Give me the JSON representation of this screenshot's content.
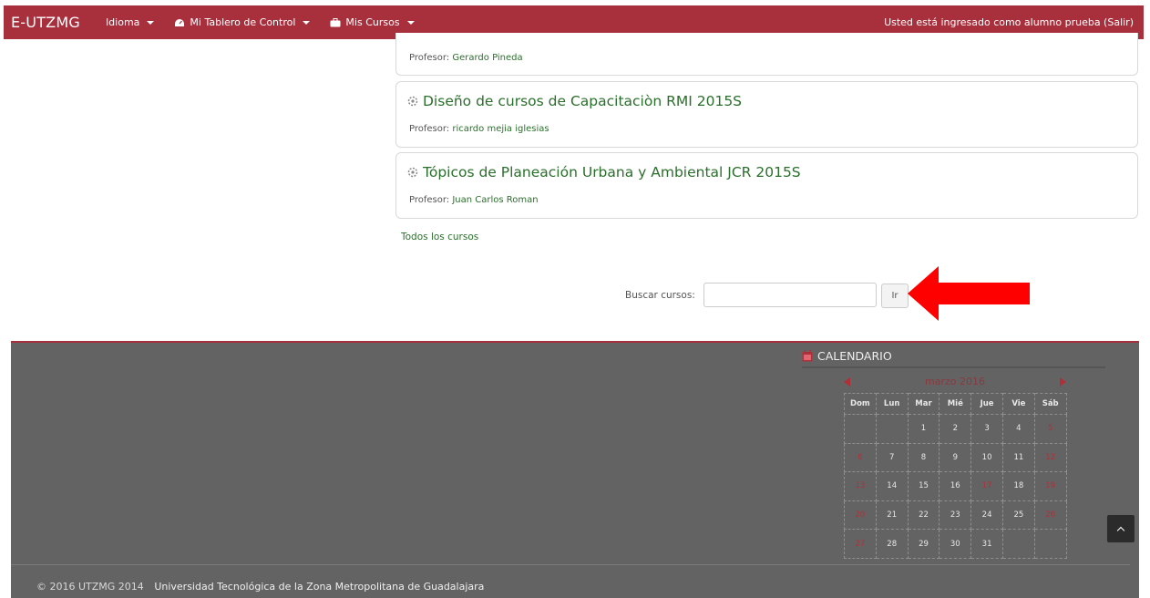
{
  "navbar": {
    "brand": "E-UTZMG",
    "language": "Idioma",
    "dashboard": "Mi Tablero de Control",
    "my_courses": "Mis Cursos",
    "login_info": "Usted está ingresado como alumno prueba (Salir)"
  },
  "courses": [
    {
      "teacher_label": "Profesor:",
      "teacher": "Gerardo Pineda"
    },
    {
      "title": "Diseño de cursos de Capacitaciòn RMI 2015S",
      "teacher_label": "Profesor:",
      "teacher": "ricardo mejia iglesias"
    },
    {
      "title": "Tópicos de Planeación Urbana y Ambiental JCR 2015S",
      "teacher_label": "Profesor:",
      "teacher": "Juan Carlos Roman"
    }
  ],
  "all_courses_link": "Todos los cursos",
  "search": {
    "label": "Buscar cursos:",
    "value": "",
    "button": "Ir"
  },
  "calendar": {
    "title": "CALENDARIO",
    "month": "marzo 2016",
    "weekdays": [
      "Dom",
      "Lun",
      "Mar",
      "Mié",
      "Jue",
      "Vie",
      "Sáb"
    ],
    "weeks": [
      [
        "",
        "",
        "1",
        "2",
        "3",
        "4",
        "5"
      ],
      [
        "6",
        "7",
        "8",
        "9",
        "10",
        "11",
        "12"
      ],
      [
        "13",
        "14",
        "15",
        "16",
        "17",
        "18",
        "19"
      ],
      [
        "20",
        "21",
        "22",
        "23",
        "24",
        "25",
        "26"
      ],
      [
        "27",
        "28",
        "29",
        "30",
        "31",
        "",
        ""
      ]
    ],
    "weekend_color": "#b0303a"
  },
  "footer": {
    "copyright": "© 2016 UTZMG 2014",
    "organization": "Universidad Tecnológica de la Zona Metropolitana de Guadalajara"
  },
  "colors": {
    "brand": "#a8303d",
    "link": "#2a6f2b",
    "footer_bg": "#636363"
  }
}
